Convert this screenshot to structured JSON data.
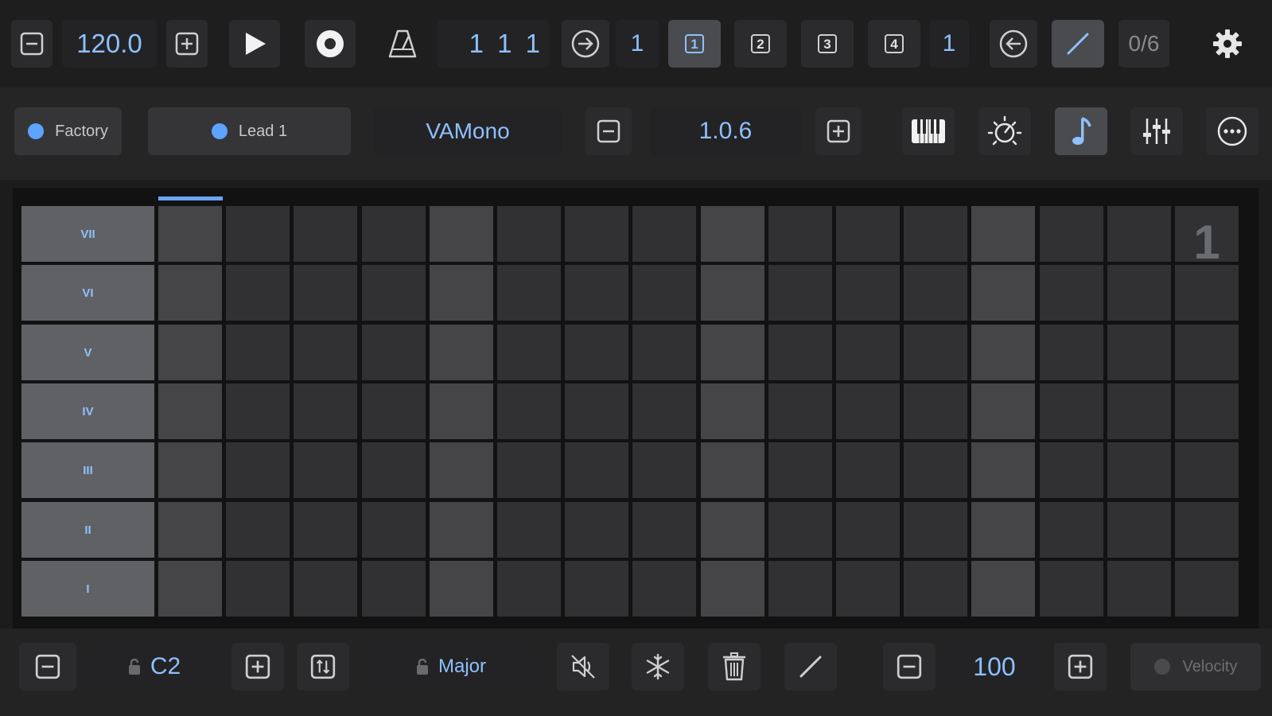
{
  "transport": {
    "tempo": "120.0",
    "position": "1 1 1",
    "loop_start_value": "1",
    "loop_end_value": "1",
    "pattern_buttons": [
      "1",
      "2",
      "3",
      "4"
    ],
    "selected_pattern": "1",
    "counter": "0/6"
  },
  "instrument": {
    "bank": "Factory",
    "preset": "Lead 1",
    "synth": "VAMono",
    "version": "1.0.6"
  },
  "grid": {
    "rows": [
      "VII",
      "VI",
      "V",
      "IV",
      "III",
      "II",
      "I"
    ],
    "steps": 16,
    "page": "1"
  },
  "footer": {
    "root_note": "C2",
    "scale": "Major",
    "velocity_value": "100",
    "velocity_label": "Velocity"
  },
  "colors": {
    "accent": "#8ec0ff",
    "background": "#1c1c1d",
    "cell_dark": "#313133",
    "cell_light": "#454548",
    "row_label": "#606164"
  }
}
